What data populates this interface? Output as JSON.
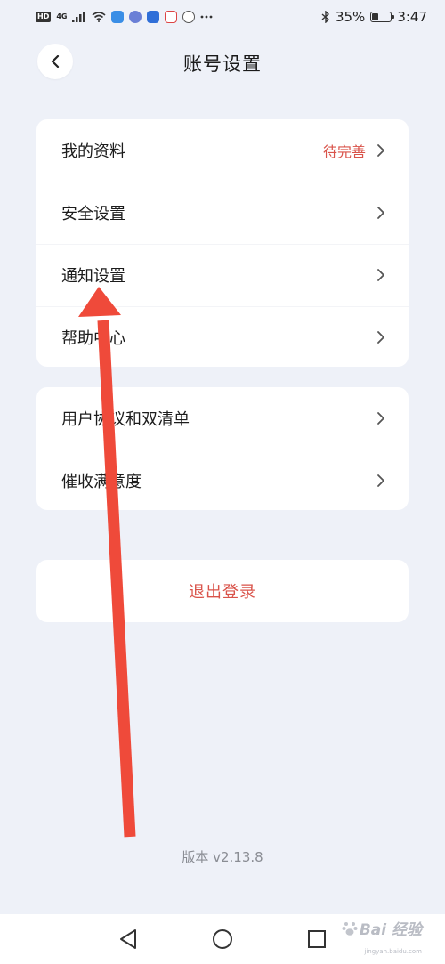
{
  "status_bar": {
    "left_badge": "HD",
    "network": "4G",
    "battery_percent": "35%",
    "battery_level": 0.35,
    "time": "3:47",
    "icons": [
      "signal-icon",
      "wifi-icon",
      "cloud-app-icon",
      "music-app-icon",
      "app-icon",
      "calendar-app-icon",
      "chat-app-icon",
      "more-dots-icon",
      "bluetooth-icon",
      "battery-icon"
    ]
  },
  "header": {
    "title": "账号设置",
    "back_icon": "chevron-left-icon"
  },
  "group1": [
    {
      "label": "我的资料",
      "status": "待完善"
    },
    {
      "label": "安全设置",
      "status": ""
    },
    {
      "label": "通知设置",
      "status": ""
    },
    {
      "label": "帮助中心",
      "status": ""
    }
  ],
  "group2": [
    {
      "label": "用户协议和双清单",
      "status": ""
    },
    {
      "label": "催收满意度",
      "status": ""
    }
  ],
  "logout_label": "退出登录",
  "version": "版本 v2.13.8",
  "nav": {
    "back_icon": "nav-back-icon",
    "home_icon": "nav-home-icon",
    "recent_icon": "nav-recent-icon"
  },
  "watermark": {
    "text": "Bai 经验",
    "sub": "jingyan.baidu.com"
  },
  "colors": {
    "background": "#eef1f8",
    "accent_red": "#d9534a",
    "arrow_red": "#ef4a3a"
  }
}
